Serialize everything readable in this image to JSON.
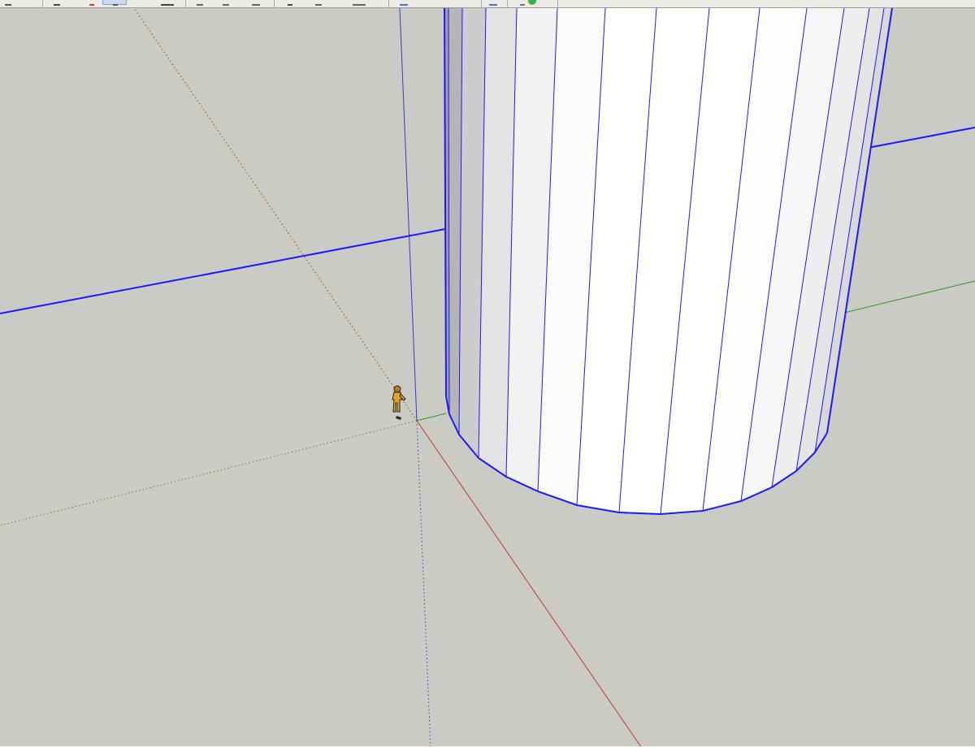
{
  "app": {
    "accent_color": "#c9dbf3"
  },
  "toolbar": {
    "buttons": [
      {
        "name": "select-tool-button",
        "icon": "arrow-icon"
      },
      {
        "name": "make-component-button",
        "icon": "component-icon"
      },
      {
        "name": "eraser-tool-button",
        "icon": "eraser-icon"
      },
      {
        "name": "paint-bucket-button",
        "icon": "paint-bucket-icon",
        "active": true
      },
      {
        "name": "rectangle-tool-button",
        "icon": "rectangle-icon"
      },
      {
        "name": "line-tool-button",
        "icon": "pencil-icon"
      },
      {
        "name": "arc-tool-button",
        "icon": "arc-icon"
      },
      {
        "name": "push-pull-button",
        "icon": "push-pull-icon"
      },
      {
        "name": "move-tool-button",
        "icon": "move-icon"
      },
      {
        "name": "rotate-tool-button",
        "icon": "rotate-icon"
      },
      {
        "name": "tape-measure-button",
        "icon": "tape-measure-icon"
      },
      {
        "name": "orbit-tool-button",
        "icon": "orbit-icon"
      },
      {
        "name": "zoom-tool-button",
        "icon": "zoom-icon"
      },
      {
        "name": "warehouse-button",
        "icon": "warehouse-icon"
      }
    ]
  },
  "viewport": {
    "background_color": "#cbcbc6",
    "axis_colors": {
      "red": "#c0392b",
      "green": "#2e9b2e",
      "blue": "#2f3fc9"
    },
    "selection_color": "#1a1aff",
    "model": {
      "object": "cylinder",
      "figure": "scale-person-icon"
    }
  }
}
